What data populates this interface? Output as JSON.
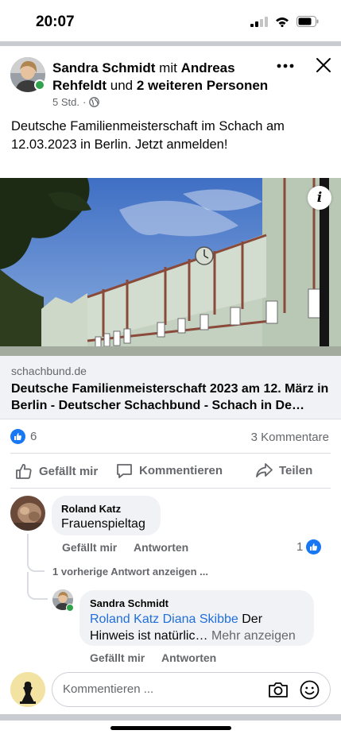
{
  "status_bar": {
    "time": "20:07"
  },
  "post": {
    "author": "Sandra Schmidt",
    "with_word": "mit",
    "tagged_person": "Andreas Rehfeldt",
    "and_word": "und",
    "others": "2 weiteren Personen",
    "time": "5 Std.",
    "separator": "·",
    "audience_icon": "globe-icon",
    "text": "Deutsche Familienmeisterschaft im Schach am 12.03.2023 in Berlin. Jetzt anmelden!",
    "link": {
      "domain": "schachbund.de",
      "title": "Deutsche Familienmeisterschaft 2023 am 12. März in Berlin - Deutscher Schachbund - Schach in De…",
      "info_label": "i"
    },
    "reactions_count": "6",
    "comments_count": "3 Kommentare",
    "actions": {
      "like": "Gefällt mir",
      "comment": "Kommentieren",
      "share": "Teilen"
    }
  },
  "comments": [
    {
      "author": "Roland Katz",
      "text": "Frauenspieltag",
      "like": "Gefällt mir",
      "reply": "Antworten",
      "reaction_count": "1",
      "previous_replies": "1 vorherige Antwort anzeigen ...",
      "replies": [
        {
          "author": "Sandra Schmidt",
          "mentions": "Roland Katz Diana Skibbe",
          "text_line1": "Der",
          "text_line2": "Hinweis ist natürlic…",
          "more": "Mehr anzeigen",
          "like": "Gefällt mir",
          "reply": "Antworten"
        }
      ]
    }
  ],
  "composer": {
    "placeholder": "Kommentieren ..."
  },
  "colors": {
    "accent": "#1877f2",
    "online": "#31a24c",
    "secondary_text": "#65676b",
    "bubble": "#f0f2f5"
  }
}
